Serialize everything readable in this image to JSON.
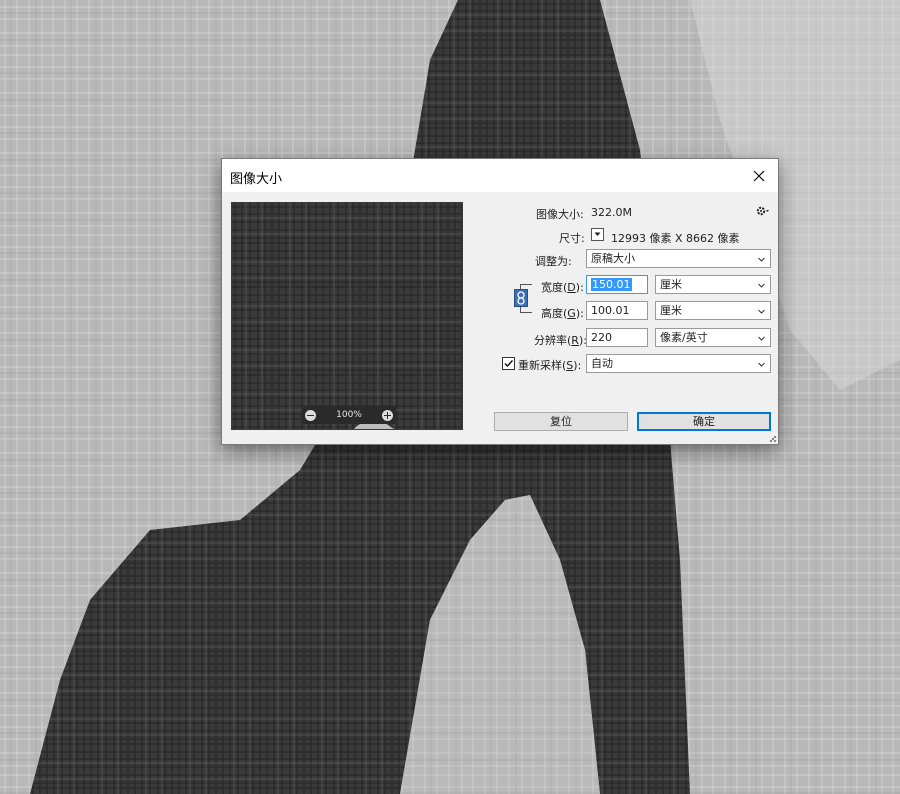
{
  "dialog": {
    "title": "图像大小",
    "close_icon": "close-icon"
  },
  "preview": {
    "zoom": "100%"
  },
  "info": {
    "image_size_label": "图像大小:",
    "image_size_value": "322.0M",
    "dimensions_label": "尺寸:",
    "dimensions_value": "12993 像素  X  8662 像素"
  },
  "fit": {
    "label": "调整为:",
    "value": "原稿大小"
  },
  "width": {
    "label_pre": "宽度(",
    "label_key": "D",
    "label_post": "):",
    "value": "150.01",
    "unit": "厘米"
  },
  "height": {
    "label_pre": "高度(",
    "label_key": "G",
    "label_post": "):",
    "value": "100.01",
    "unit": "厘米"
  },
  "resolution": {
    "label_pre": "分辨率(",
    "label_key": "R",
    "label_post": "):",
    "value": "220",
    "unit": "像素/英寸"
  },
  "resample": {
    "checked": true,
    "label_pre": "重新采样(",
    "label_key": "S",
    "label_post": "):",
    "value": "自动"
  },
  "buttons": {
    "reset": "复位",
    "ok": "确定"
  }
}
